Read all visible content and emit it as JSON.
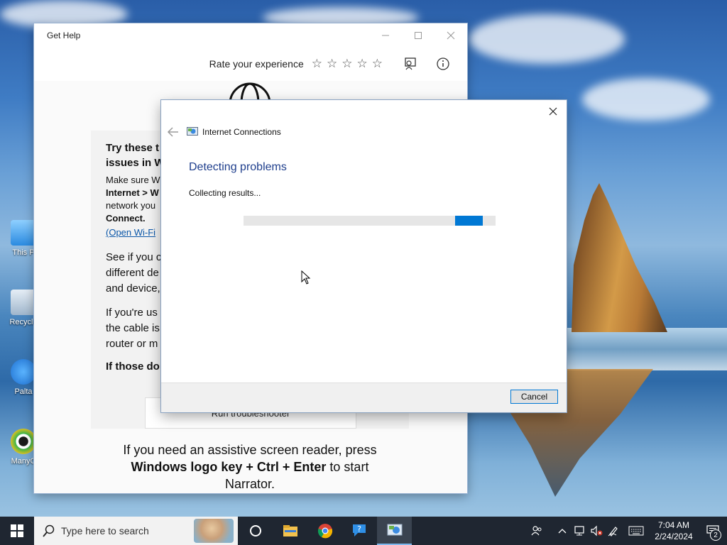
{
  "desktop": {
    "icons": [
      {
        "label": "This P",
        "icon": "computer-icon"
      },
      {
        "label": "Recycle",
        "icon": "recycle-bin-icon"
      },
      {
        "label": "Palta",
        "icon": "paltalk-icon"
      },
      {
        "label": "ManyC",
        "icon": "manycam-icon"
      }
    ]
  },
  "get_help": {
    "title": "Get Help",
    "rate_label": "Rate your experience",
    "stars": 5,
    "card": {
      "heading_line1": "Try these t",
      "heading_line2": "issues in W",
      "p1_line1": "Make sure W",
      "p1_line2": "Internet > W",
      "p1_line3": "network you",
      "p1_line4": "Connect.",
      "link": "(Open Wi-Fi",
      "p2_line1": "See if you c",
      "p2_line2": "different de",
      "p2_line3": "and device,",
      "p3_line1": "If you're us",
      "p3_line2": "the cable is",
      "p3_line3": "router or m",
      "p4": "If those do",
      "run_button": "Run troubleshooter"
    },
    "narrator_line1": "If you need an assistive screen reader, press",
    "narrator_bold": "Windows logo key + Ctrl + Enter",
    "narrator_after": " to start",
    "narrator_line3": "Narrator."
  },
  "dialog": {
    "app_title": "Internet Connections",
    "heading": "Detecting problems",
    "status": "Collecting results...",
    "progress_chunk_start": 0.84,
    "progress_chunk_width": 0.11,
    "cancel_label": "Cancel"
  },
  "taskbar": {
    "search_placeholder": "Type here to search",
    "apps": [
      "cortana-icon",
      "file-explorer-icon",
      "chrome-icon",
      "get-help-icon",
      "troubleshooter-icon"
    ],
    "time": "7:04 AM",
    "date": "2/24/2024",
    "notification_count": "2"
  },
  "colors": {
    "accent": "#0078d4",
    "dialog_heading": "#1e3e8c",
    "taskbar": "#1f2631"
  }
}
